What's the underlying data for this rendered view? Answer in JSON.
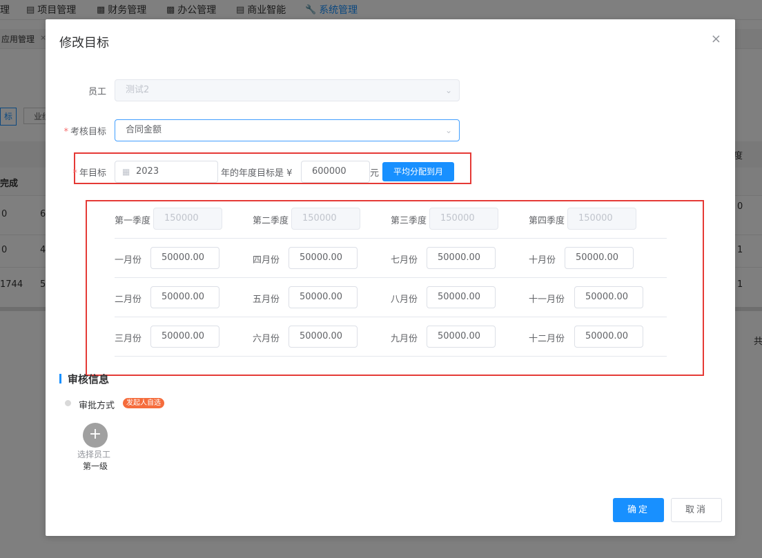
{
  "nav": {
    "items": [
      {
        "label": "理",
        "icon": "none"
      },
      {
        "label": "项目管理",
        "icon": "book-icon"
      },
      {
        "label": "财务管理",
        "icon": "finance-icon"
      },
      {
        "label": "办公管理",
        "icon": "office-icon"
      },
      {
        "label": "商业智能",
        "icon": "chart-icon"
      },
      {
        "label": "系统管理",
        "icon": "wrench-icon"
      }
    ]
  },
  "tabs": {
    "app_label": "应用管理",
    "close": "×"
  },
  "background": {
    "pill_a": "标",
    "pill_b": "业绩",
    "header_done": "完成",
    "header_right": "度",
    "rows": [
      {
        "c1": "0",
        "c2": "6",
        "c3": "0"
      },
      {
        "c1": "0",
        "c2": "4",
        "c3": "1"
      },
      {
        "c1": "1744",
        "c2": "5",
        "c3": "1"
      }
    ],
    "total_text": "共"
  },
  "modal": {
    "title": "修改目标",
    "close_icon": "×",
    "employee_label": "员工",
    "employee_value": "测试2",
    "target_label": "考核目标",
    "target_value": "合同金额",
    "year_label": "年目标",
    "year_value": "2023",
    "year_text": "年的年度目标是 ¥",
    "year_amount": "600000",
    "yuan": "元",
    "distribute_button": "平均分配到月",
    "quarters": [
      {
        "label": "第一季度",
        "value": "150000"
      },
      {
        "label": "第二季度",
        "value": "150000"
      },
      {
        "label": "第三季度",
        "value": "150000"
      },
      {
        "label": "第四季度",
        "value": "150000"
      }
    ],
    "months": [
      {
        "label": "一月份",
        "value": "50000.00"
      },
      {
        "label": "四月份",
        "value": "50000.00"
      },
      {
        "label": "七月份",
        "value": "50000.00"
      },
      {
        "label": "十月份",
        "value": "50000.00"
      },
      {
        "label": "二月份",
        "value": "50000.00"
      },
      {
        "label": "五月份",
        "value": "50000.00"
      },
      {
        "label": "八月份",
        "value": "50000.00"
      },
      {
        "label": "十一月份",
        "value": "50000.00"
      },
      {
        "label": "三月份",
        "value": "50000.00"
      },
      {
        "label": "六月份",
        "value": "50000.00"
      },
      {
        "label": "九月份",
        "value": "50000.00"
      },
      {
        "label": "十二月份",
        "value": "50000.00"
      }
    ],
    "review_title": "审核信息",
    "approval_label": "审批方式",
    "approval_badge": "发起人自选",
    "add_icon": "+",
    "select_employee": "选择员工",
    "level": "第一级",
    "confirm": "确定",
    "cancel": "取消"
  },
  "colors": {
    "primary": "#1890ff",
    "highlight_border": "#e53935",
    "badge": "#f56c3c"
  }
}
